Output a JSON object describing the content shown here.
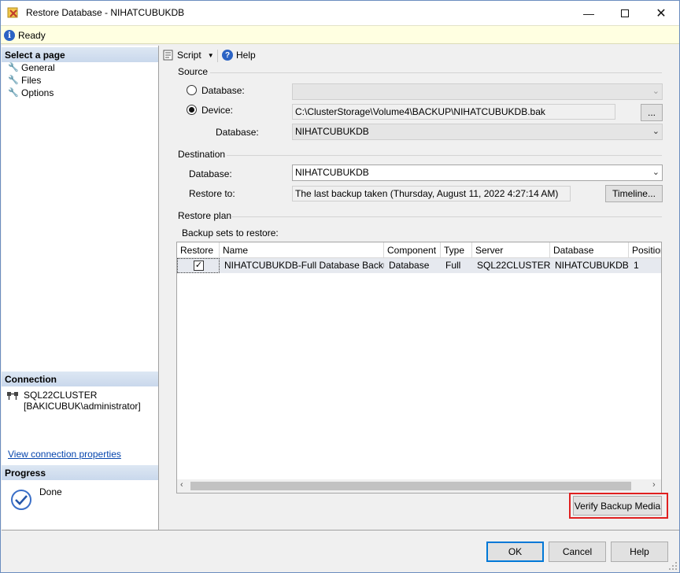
{
  "window": {
    "title": "Restore Database - NIHATCUBUKDB",
    "status": "Ready"
  },
  "left_pane": {
    "select_page_header": "Select a page",
    "pages": [
      "General",
      "Files",
      "Options"
    ],
    "connection_header": "Connection",
    "connection_server": "SQL22CLUSTER",
    "connection_user": "[BAKICUBUK\\administrator]",
    "view_connection_link": "View connection properties",
    "progress_header": "Progress",
    "progress_status": "Done"
  },
  "toolbar": {
    "script_label": "Script",
    "help_label": "Help"
  },
  "source": {
    "label": "Source",
    "database_radio_label": "Database:",
    "device_radio_label": "Device:",
    "device_path": "C:\\ClusterStorage\\Volume4\\BACKUP\\NIHATCUBUKDB.bak",
    "browse_label": "...",
    "database_label": "Database:",
    "database_value": "NIHATCUBUKDB"
  },
  "destination": {
    "label": "Destination",
    "database_label": "Database:",
    "database_value": "NIHATCUBUKDB",
    "restore_to_label": "Restore to:",
    "restore_to_value": "The last backup taken (Thursday, August 11, 2022 4:27:14 AM)",
    "timeline_label": "Timeline..."
  },
  "restore_plan": {
    "label": "Restore plan",
    "backup_sets_label": "Backup sets to restore:",
    "columns": [
      "Restore",
      "Name",
      "Component",
      "Type",
      "Server",
      "Database",
      "Position"
    ],
    "rows": [
      {
        "restore": true,
        "name": "NIHATCUBUKDB-Full Database Backup",
        "component": "Database",
        "type": "Full",
        "server": "SQL22CLUSTER",
        "database": "NIHATCUBUKDB",
        "position": "1"
      }
    ],
    "verify_label": "Verify Backup Media"
  },
  "footer": {
    "ok_label": "OK",
    "cancel_label": "Cancel",
    "help_label": "Help"
  },
  "colors": {
    "accent": "#0078d7",
    "highlight": "#e02020"
  }
}
